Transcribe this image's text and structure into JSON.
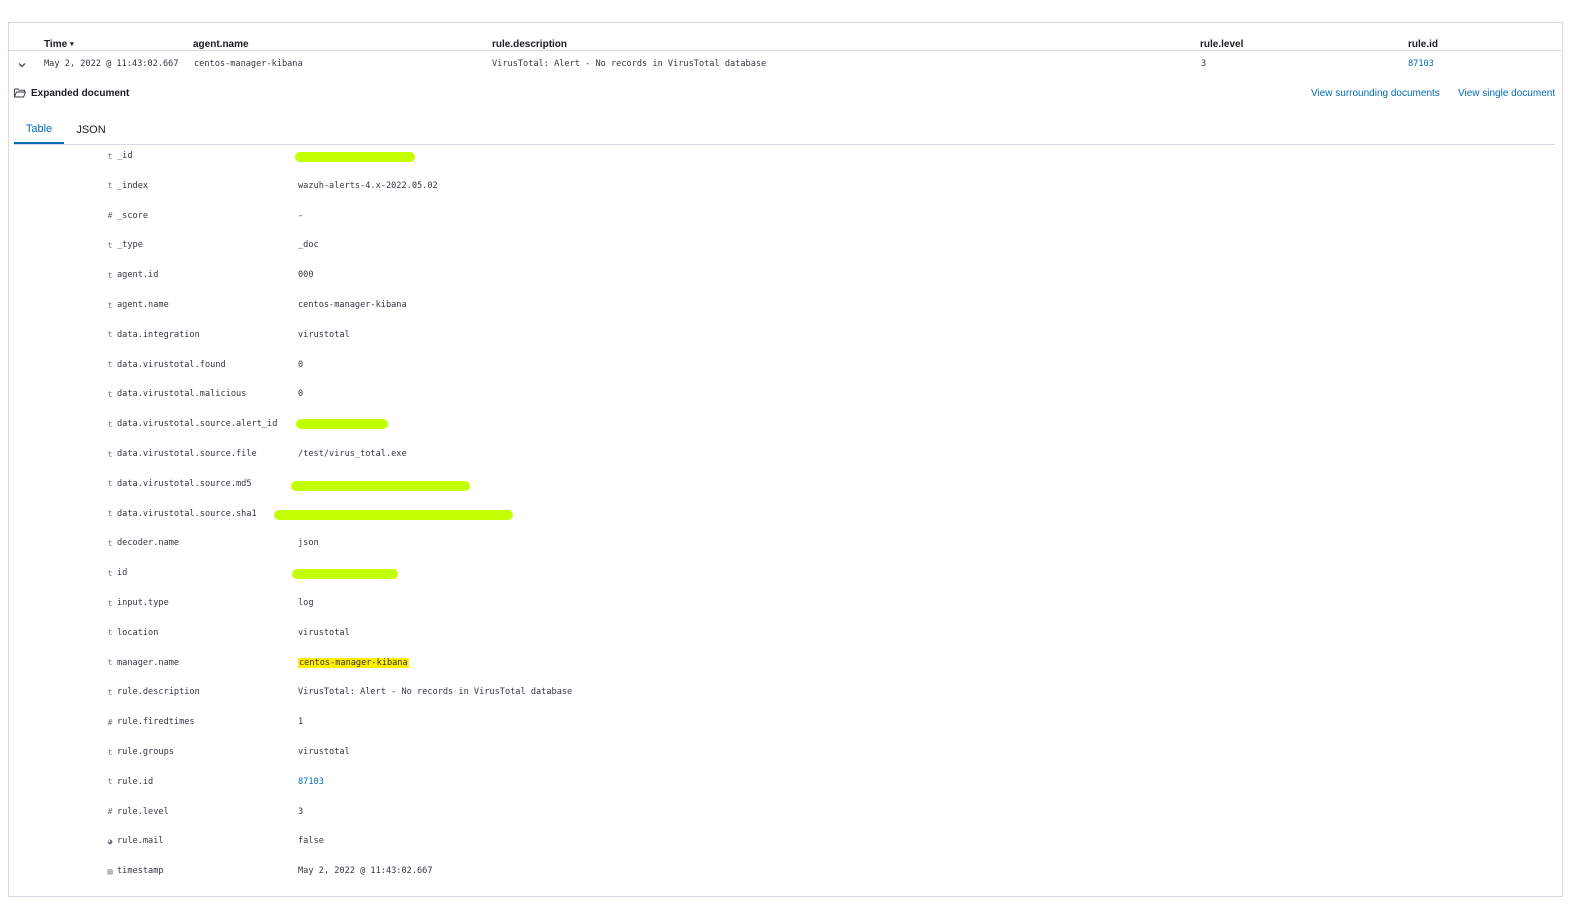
{
  "columns": {
    "time": "Time",
    "agent": "agent.name",
    "desc": "rule.description",
    "level": "rule.level",
    "rid": "rule.id"
  },
  "result_row": {
    "time": "May 2, 2022 @ 11:43:02.667",
    "agent": "centos-manager-kibana",
    "desc": "VirusTotal: Alert - No records in VirusTotal database",
    "level": "3",
    "rid": "87103"
  },
  "expanded_label": "Expanded document",
  "links": {
    "surrounding": "View surrounding documents",
    "single": "View single document"
  },
  "tabs": {
    "table": "Table",
    "json": "JSON"
  },
  "fields": [
    {
      "icon": "t",
      "name": "_id",
      "value": ""
    },
    {
      "icon": "t",
      "name": "_index",
      "value": "wazuh-alerts-4.x-2022.05.02"
    },
    {
      "icon": "#",
      "name": "_score",
      "value": " -"
    },
    {
      "icon": "t",
      "name": "_type",
      "value": "_doc"
    },
    {
      "icon": "t",
      "name": "agent.id",
      "value": "000"
    },
    {
      "icon": "t",
      "name": "agent.name",
      "value": "centos-manager-kibana"
    },
    {
      "icon": "t",
      "name": "data.integration",
      "value": "virustotal"
    },
    {
      "icon": "t",
      "name": "data.virustotal.found",
      "value": "0"
    },
    {
      "icon": "t",
      "name": "data.virustotal.malicious",
      "value": "0"
    },
    {
      "icon": "t",
      "name": "data.virustotal.source.alert_id",
      "value": ""
    },
    {
      "icon": "t",
      "name": "data.virustotal.source.file",
      "value": "/test/virus_total.exe"
    },
    {
      "icon": "t",
      "name": "data.virustotal.source.md5",
      "value": ""
    },
    {
      "icon": "t",
      "name": "data.virustotal.source.sha1",
      "value": ""
    },
    {
      "icon": "t",
      "name": "decoder.name",
      "value": "json"
    },
    {
      "icon": "t",
      "name": "id",
      "value": ""
    },
    {
      "icon": "t",
      "name": "input.type",
      "value": "log"
    },
    {
      "icon": "t",
      "name": "location",
      "value": "virustotal"
    },
    {
      "icon": "t",
      "name": "manager.name",
      "value": "centos-manager-kibana"
    },
    {
      "icon": "t",
      "name": "rule.description",
      "value": "VirusTotal: Alert - No records in VirusTotal database"
    },
    {
      "icon": "#",
      "name": "rule.firedtimes",
      "value": "1"
    },
    {
      "icon": "t",
      "name": "rule.groups",
      "value": "virustotal"
    },
    {
      "icon": "t",
      "name": "rule.id",
      "value": "87103"
    },
    {
      "icon": "#",
      "name": "rule.level",
      "value": "3"
    },
    {
      "icon": "◕",
      "name": "rule.mail",
      "value": "false"
    },
    {
      "icon": "▤",
      "name": "timestamp",
      "value": "May 2, 2022 @ 11:43:02.667"
    }
  ],
  "colors": {
    "link": "#006bb4",
    "highlight": "#ffee00",
    "redaction": "#c4ff00"
  }
}
